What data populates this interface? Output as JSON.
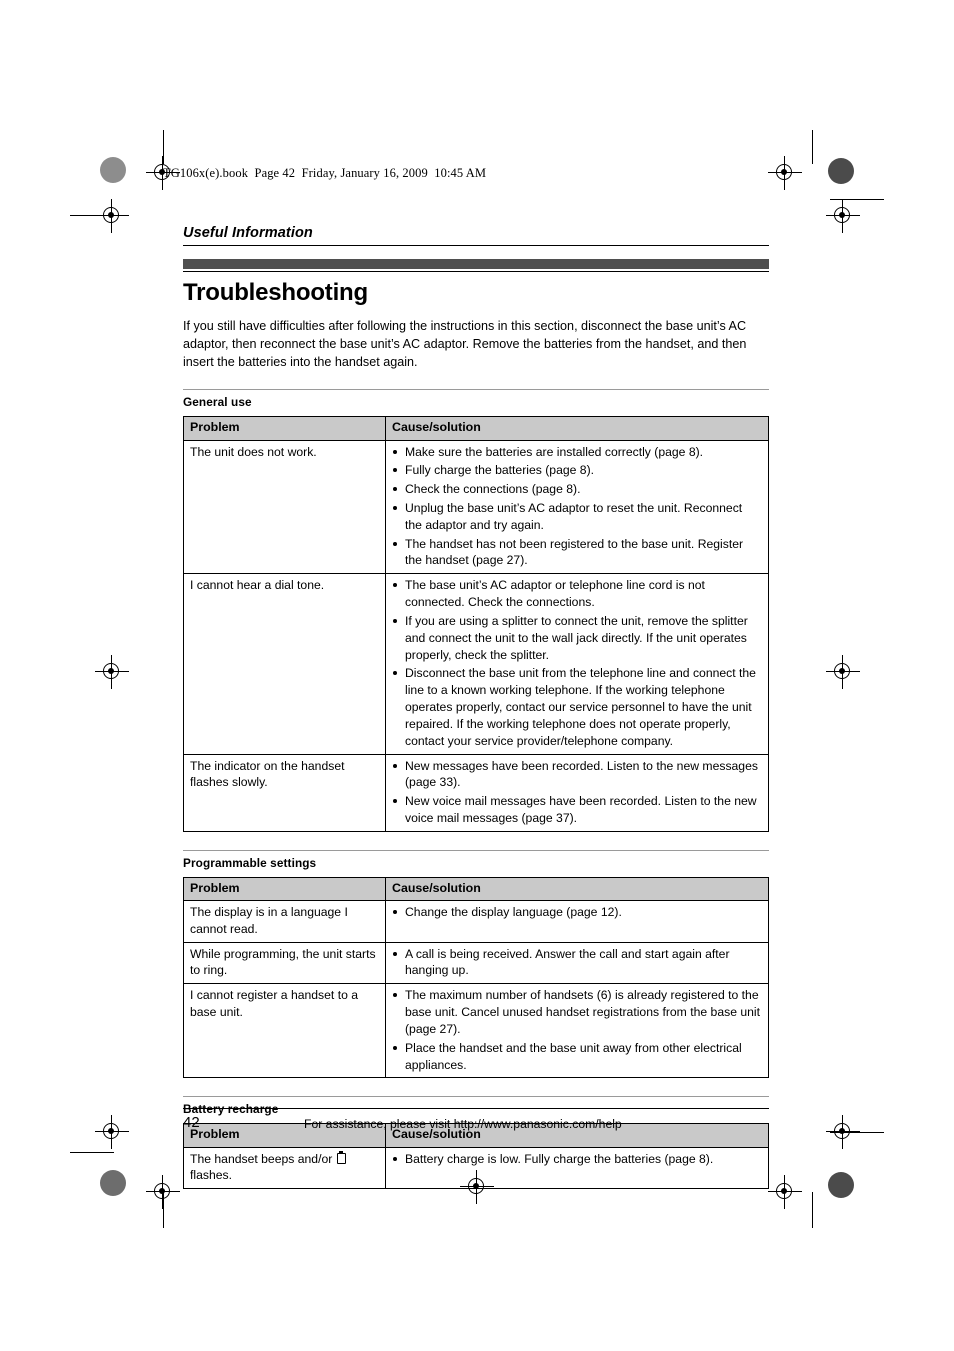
{
  "page": {
    "book_line": "TG106x(e).book  Page 42  Friday, January 16, 2009  10:45 AM",
    "running_head": "Useful Information",
    "title": "Troubleshooting",
    "intro": "If you still have difficulties after following the instructions in this section, disconnect the base unit’s AC adaptor, then reconnect the base unit’s AC adaptor. Remove the batteries from the handset, and then insert the batteries into the handset again.",
    "accent_bar_color": "#4f4f4f",
    "table_header_color": "#c9c9c9"
  },
  "columns": {
    "problem": "Problem",
    "cause": "Cause/solution"
  },
  "sections": [
    {
      "label": "General use",
      "rows": [
        {
          "problem": "The unit does not work.",
          "causes": [
            "Make sure the batteries are installed correctly (page 8).",
            "Fully charge the batteries (page 8).",
            "Check the connections (page 8).",
            "Unplug the base unit’s AC adaptor to reset the unit. Reconnect the adaptor and try again.",
            "The handset has not been registered to the base unit. Register the handset (page 27)."
          ]
        },
        {
          "problem": "I cannot hear a dial tone.",
          "causes": [
            "The base unit’s AC adaptor or telephone line cord is not connected. Check the connections.",
            "If you are using a splitter to connect the unit, remove the splitter and connect the unit to the wall jack directly. If the unit operates properly, check the splitter.",
            "Disconnect the base unit from the telephone line and connect the line to a known working telephone. If the working telephone operates properly, contact our service personnel to have the unit repaired. If the working telephone does not operate properly, contact your service provider/telephone company."
          ]
        },
        {
          "problem": "The indicator on the handset flashes slowly.",
          "causes": [
            "New messages have been recorded. Listen to the new messages (page 33).",
            "New voice mail messages have been recorded. Listen to the new voice mail messages (page 37)."
          ]
        }
      ]
    },
    {
      "label": "Programmable settings",
      "rows": [
        {
          "problem": "The display is in a language I cannot read.",
          "causes": [
            "Change the display language (page 12)."
          ]
        },
        {
          "problem": "While programming, the unit starts to ring.",
          "causes": [
            "A call is being received. Answer the call and start again after hanging up."
          ]
        },
        {
          "problem": "I cannot register a handset to a base unit.",
          "causes": [
            "The maximum number of handsets (6) is already registered to the base unit. Cancel unused handset registrations from the base unit (page 27).",
            "Place the handset and the base unit away from other electrical appliances."
          ]
        }
      ]
    },
    {
      "label": "Battery recharge",
      "rows": [
        {
          "problem_before_icon": "The handset beeps and/or ",
          "problem_icon": "battery-icon",
          "problem_after_icon": " flashes.",
          "causes": [
            "Battery charge is low. Fully charge the batteries (page 8)."
          ]
        }
      ]
    }
  ],
  "footer": {
    "page_number": "42",
    "assistance": "For assistance, please visit http://www.panasonic.com/help"
  }
}
